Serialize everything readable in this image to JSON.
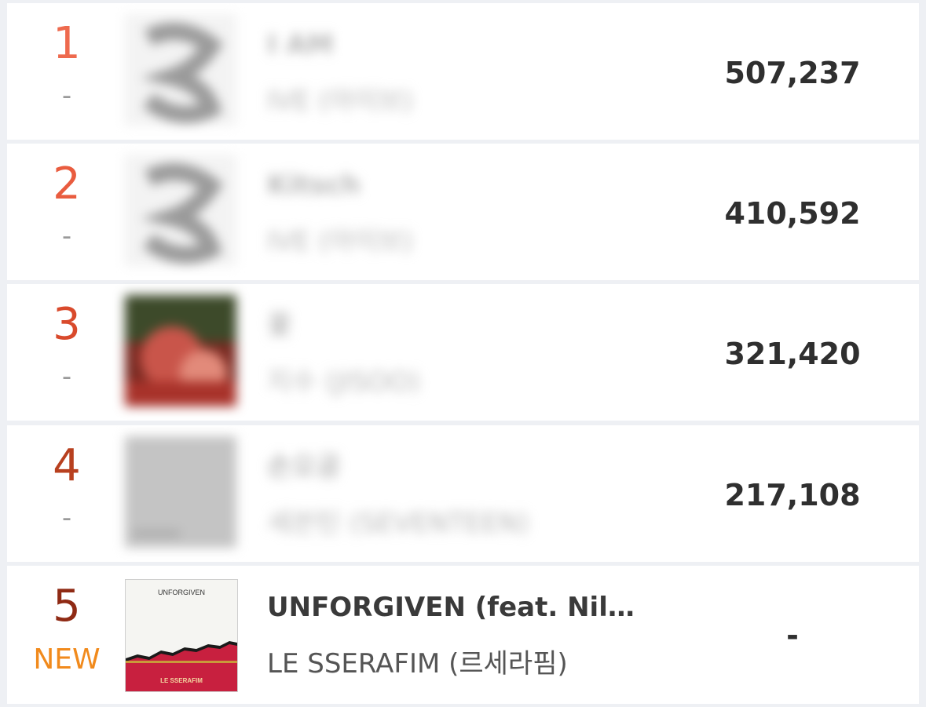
{
  "chart_rows": [
    {
      "rank": "1",
      "change": "-",
      "title": "I AM",
      "artist": "IVE (아이브)",
      "count": "507,237"
    },
    {
      "rank": "2",
      "change": "-",
      "title": "Kitsch",
      "artist": "IVE (아이브)",
      "count": "410,592"
    },
    {
      "rank": "3",
      "change": "-",
      "title": "꽃",
      "artist": "지수 (JISOO)",
      "count": "321,420"
    },
    {
      "rank": "4",
      "change": "-",
      "title": "손오공",
      "artist": "세븐틴 (SEVENTEEN)",
      "count": "217,108"
    },
    {
      "rank": "5",
      "change": "NEW",
      "title": "UNFORGIVEN (feat. Nil…",
      "artist": "LE SSERAFIM (르세라핌)",
      "count": "-",
      "cover_text_top": "UNFORGIVEN",
      "cover_text_bottom": "LE SSERAFIM"
    }
  ],
  "colors": {
    "rank_1": "#ee6a4e",
    "rank_2": "#e95c3f",
    "rank_3": "#d94a2c",
    "rank_4": "#b8401f",
    "rank_5": "#8f2a14",
    "new_badge": "#f18a1c",
    "background": "#eef0f4"
  }
}
